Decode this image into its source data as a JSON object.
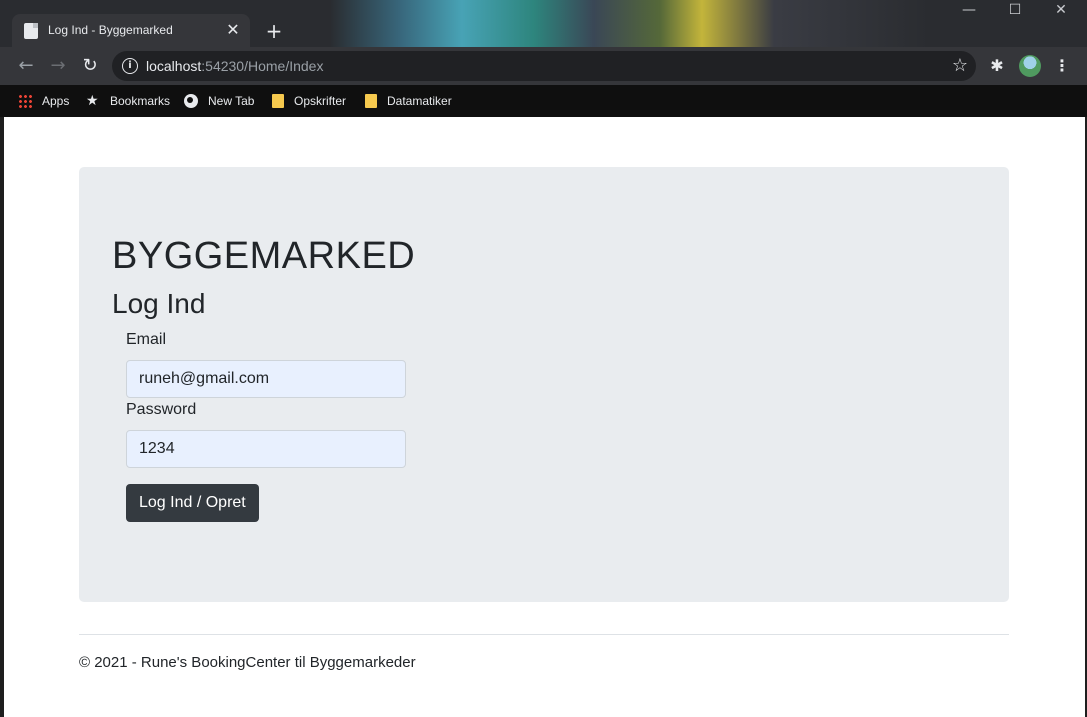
{
  "browser": {
    "tab_title": "Log Ind - Byggemarked",
    "tab_close": "✕",
    "new_tab": "+",
    "window_controls": {
      "minimize": "—",
      "maximize": "☐",
      "close": "✕"
    },
    "url_host": "localhost",
    "url_path": ":54230/Home/Index",
    "bookmarks": [
      "Apps",
      "Bookmarks",
      "New Tab",
      "Opskrifter",
      "Datamatiker"
    ]
  },
  "page": {
    "brand": "BYGGEMARKED",
    "heading": "Log Ind",
    "email_label": "Email",
    "email_value": "runeh@gmail.com",
    "password_label": "Password",
    "password_value": "1234",
    "submit_label": "Log Ind / Opret",
    "footer": "© 2021 - Rune's BookingCenter til Byggemarkeder"
  }
}
